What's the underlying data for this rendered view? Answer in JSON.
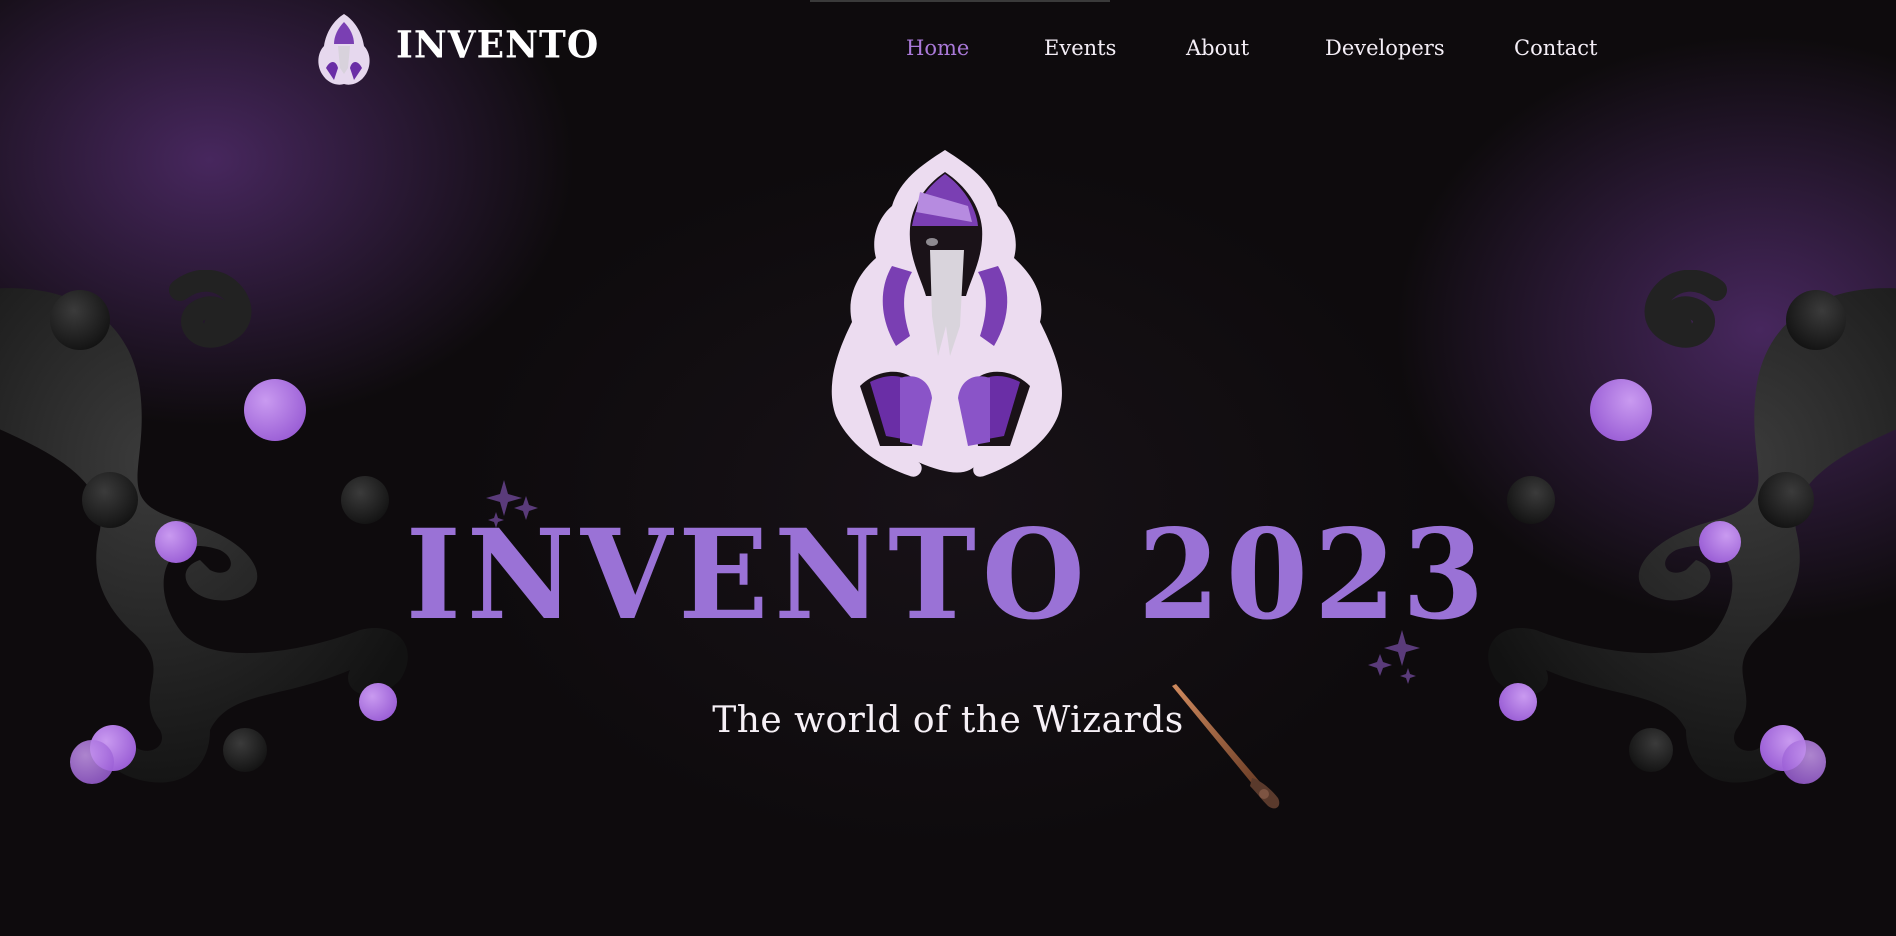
{
  "nav": {
    "brand": "INVENTO",
    "links": [
      {
        "label": "Home",
        "active": true
      },
      {
        "label": "Events",
        "active": false
      },
      {
        "label": "About",
        "active": false
      },
      {
        "label": "Developers",
        "active": false
      },
      {
        "label": "Contact",
        "active": false
      }
    ]
  },
  "hero": {
    "title": "INVENTO 2023",
    "subtitle": "The world of the Wizards"
  },
  "colors": {
    "accent": "#9a72d6",
    "active_link": "#a979d8",
    "background": "#0e0b0d",
    "orb": "#b57be6"
  },
  "icons": [
    "wizard-logo-icon",
    "wizard-emblem-icon",
    "sparkle-icon",
    "wand-icon"
  ]
}
